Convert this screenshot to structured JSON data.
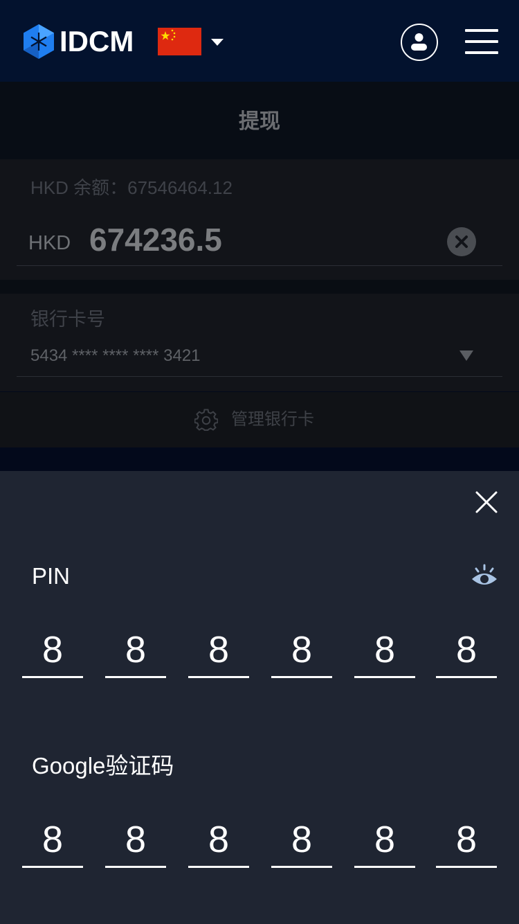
{
  "header": {
    "logo_text": "IDCM",
    "flag_name": "china-flag",
    "colors": {
      "background": "#03122e",
      "logo_blue": "#1f7ef0",
      "flag_red": "#de2910",
      "flag_yellow": "#ffde00"
    }
  },
  "page": {
    "title": "提现"
  },
  "amount": {
    "balance_label": "HKD 余额：67546464.12",
    "currency": "HKD",
    "value": "674236.5"
  },
  "bank": {
    "label": "银行卡号",
    "card_number": "5434 **** **** **** 3421",
    "manage_label": "管理银行卡"
  },
  "sheet": {
    "pin_label": "PIN",
    "pin_digits": [
      "8",
      "8",
      "8",
      "8",
      "8",
      "8"
    ],
    "google_label": "Google验证码",
    "google_digits": [
      "8",
      "8",
      "8",
      "8",
      "8",
      "8"
    ],
    "colors": {
      "background": "#1f2532",
      "eye": "#a9c4e4"
    }
  }
}
